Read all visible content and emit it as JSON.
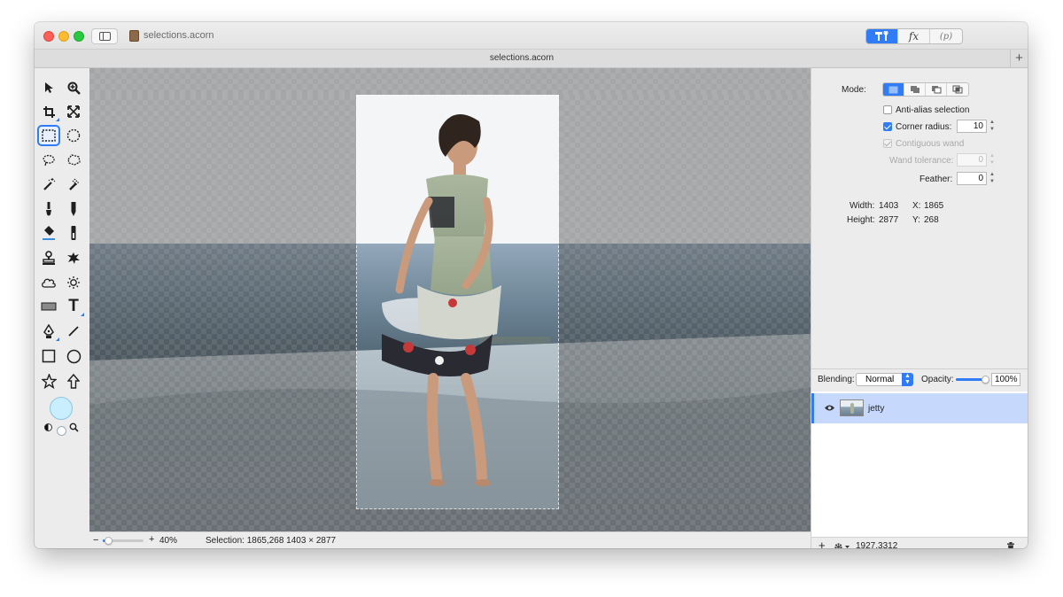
{
  "window": {
    "document_title": "selections.acorn",
    "tab_title": "selections.acorn",
    "tab_add": "+"
  },
  "toolbar_segments": [
    {
      "name": "tools-panel",
      "icon": "hammer-wrench-icon",
      "active": true
    },
    {
      "name": "effects-panel",
      "label": "fx",
      "active": false
    },
    {
      "name": "properties-panel",
      "label": "(p)",
      "active": false
    }
  ],
  "tools": {
    "items": [
      "select-arrow",
      "zoom",
      "crop",
      "transform",
      "rect-select",
      "ellipse-select",
      "lasso",
      "polygon-lasso",
      "magic-wand",
      "color-select",
      "brush",
      "pencil",
      "paint-bucket",
      "gradient",
      "clone-stamp",
      "smudge",
      "cloud",
      "sun",
      "rect-shape",
      "text",
      "pen",
      "line",
      "rectangle",
      "oval",
      "star",
      "arrow"
    ],
    "selected": "rect-select",
    "text_label": "T",
    "fill_color": "#c9efff"
  },
  "inspector": {
    "mode_label": "Mode:",
    "anti_alias": {
      "label": "Anti-alias selection",
      "checked": false
    },
    "corner_radius": {
      "label": "Corner radius:",
      "checked": true,
      "value": "10"
    },
    "contiguous_wand": {
      "label": "Contiguous wand",
      "checked": true,
      "disabled": true
    },
    "wand_tolerance": {
      "label": "Wand tolerance:",
      "value": "0",
      "disabled": true
    },
    "feather": {
      "label": "Feather:",
      "value": "0"
    },
    "width_label": "Width:",
    "width_value": "1403",
    "height_label": "Height:",
    "height_value": "2877",
    "x_label": "X:",
    "x_value": "1865",
    "y_label": "Y:",
    "y_value": "268"
  },
  "layers": {
    "blending_label": "Blending:",
    "blending_value": "Normal",
    "opacity_label": "Opacity:",
    "opacity_value": "100%",
    "opacity_level": 1.0,
    "items": [
      {
        "name": "jetty",
        "visible": true,
        "selected": true
      }
    ],
    "footer_coords": "1927,3312",
    "add_label": "+"
  },
  "status": {
    "zoom_minus": "−",
    "zoom_plus": "+",
    "zoom_value": "40%",
    "zoom_level": 0.15,
    "selection_text": "Selection: 1865,268 1403 × 2877"
  }
}
